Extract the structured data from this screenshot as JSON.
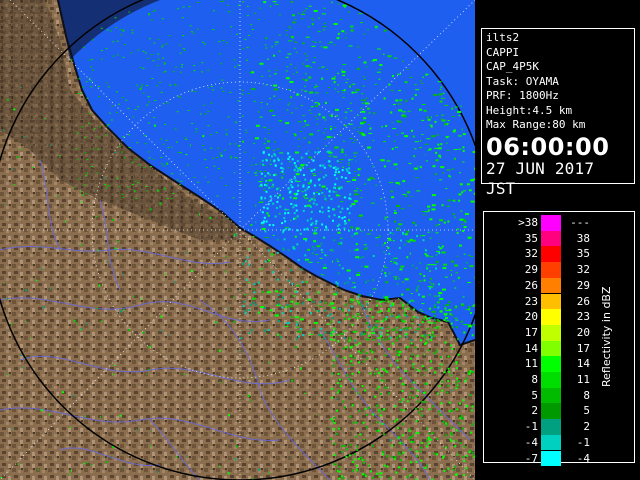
{
  "info": {
    "radar_id": "ilts2",
    "product": "CAPPI",
    "scan": "CAP_4P5K",
    "task": "Task: OYAMA",
    "prf": "PRF: 1800Hz",
    "height": "Height:4.5 km",
    "max_range": "Max Range:80 km",
    "time": "06:00:00",
    "date": "27 JUN 2017 JST"
  },
  "legend": {
    "title": "Reflectivity in dBZ",
    "rows": [
      {
        "low": ">38",
        "high": "---",
        "color": "#ff00ff"
      },
      {
        "low": "35",
        "high": "38",
        "color": "#ff007f"
      },
      {
        "low": "32",
        "high": "35",
        "color": "#ff0000"
      },
      {
        "low": "29",
        "high": "32",
        "color": "#ff3f00"
      },
      {
        "low": "26",
        "high": "29",
        "color": "#ff7f00"
      },
      {
        "low": "23",
        "high": "26",
        "color": "#ffbf00"
      },
      {
        "low": "20",
        "high": "23",
        "color": "#ffff00"
      },
      {
        "low": "17",
        "high": "20",
        "color": "#bfff00"
      },
      {
        "low": "14",
        "high": "17",
        "color": "#7fff00"
      },
      {
        "low": "11",
        "high": "14",
        "color": "#00ff00"
      },
      {
        "low": "8",
        "high": "11",
        "color": "#00dd00"
      },
      {
        "low": "5",
        "high": "8",
        "color": "#00bb00"
      },
      {
        "low": "2",
        "high": "5",
        "color": "#009900"
      },
      {
        "low": "-1",
        "high": "2",
        "color": "#00a080"
      },
      {
        "low": "-4",
        "high": "-1",
        "color": "#00d0c0"
      },
      {
        "low": "-7",
        "high": "-4",
        "color": "#00ffff"
      }
    ]
  },
  "map": {
    "land_color": "#8a6e4e",
    "sea_color": "#1e5ff0",
    "river_color": "#6a6ad8",
    "coast_color": "#101018",
    "range_ring_color": "#ffffff",
    "echo_colors": [
      "#00ff00",
      "#00dd00",
      "#00bb00",
      "#00a080",
      "#00d0c0",
      "#00ffff"
    ]
  }
}
